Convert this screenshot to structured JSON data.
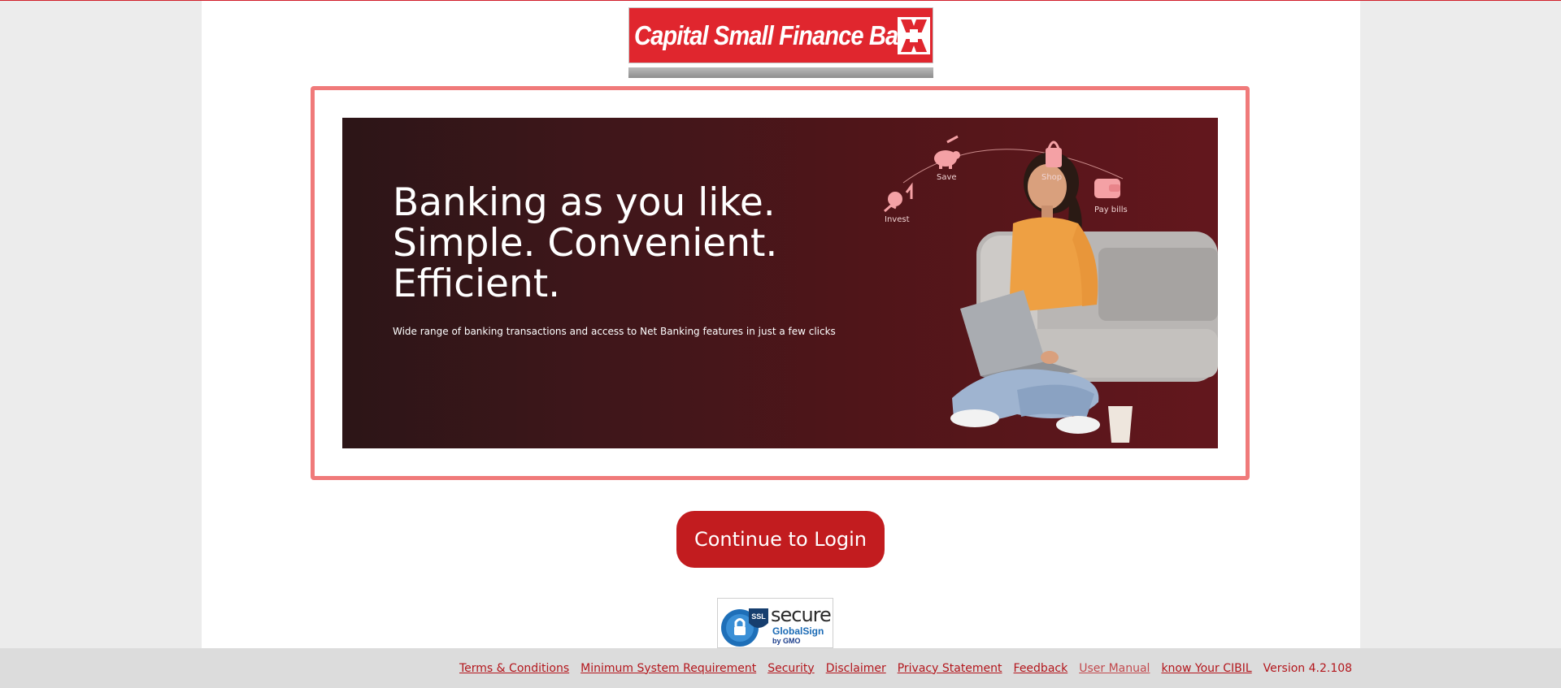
{
  "logo": {
    "text": "Capital Small Finance Bank",
    "brand_color": "#e0262e"
  },
  "banner": {
    "headline": [
      "Banking as you like.",
      "Simple. Convenient.",
      "Efficient."
    ],
    "subtext": "Wide range of banking transactions and access to Net Banking features in just a few clicks",
    "icons": {
      "invest": "Invest",
      "save": "Save",
      "shop": "Shop",
      "pay_bills": "Pay bills"
    }
  },
  "continue_button": {
    "label": "Continue to Login",
    "color": "#c21c1f"
  },
  "ssl_badge": {
    "ssl": "SSL",
    "secure": "secure",
    "provider": "GlobalSign",
    "by": "by GMO"
  },
  "footer": {
    "links": [
      "Terms & Conditions",
      "Minimum System Requirement",
      "Security",
      "Disclaimer",
      "Privacy Statement",
      "Feedback",
      "User Manual",
      "know Your CIBIL"
    ],
    "version": "Version 4.2.108",
    "link_color": "#b3161c"
  }
}
